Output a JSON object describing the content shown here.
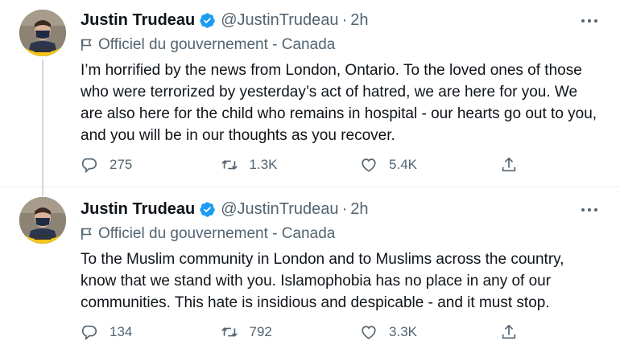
{
  "tweets": [
    {
      "author_name": "Justin Trudeau",
      "handle": "@JustinTrudeau",
      "separator": "·",
      "time": "2h",
      "gov_label": "Officiel du gouvernement - Canada",
      "text": "I’m horrified by the news from London, Ontario. To the loved ones of those who were terrorized by yesterday’s act of hatred, we are here for you. We are also here for the child who remains in hospital - our hearts go out to you, and you will be in our thoughts as you recover.",
      "replies": "275",
      "retweets": "1.3K",
      "likes": "5.4K"
    },
    {
      "author_name": "Justin Trudeau",
      "handle": "@JustinTrudeau",
      "separator": "·",
      "time": "2h",
      "gov_label": "Officiel du gouvernement - Canada",
      "text": "To the Muslim community in London and to Muslims across the country, know that we stand with you. Islamophobia has no place in any of our communities. This hate is insidious and despicable - and it must stop.",
      "replies": "134",
      "retweets": "792",
      "likes": "3.3K"
    }
  ],
  "colors": {
    "text": "#0f1419",
    "secondary": "#536471",
    "verified": "#1d9bf0",
    "divider": "#e6ecf0",
    "avatar_ring": "#f5c518"
  },
  "icons": [
    "verified-badge-icon",
    "more-icon",
    "gov-flag-icon",
    "reply-icon",
    "retweet-icon",
    "like-icon",
    "share-icon"
  ]
}
